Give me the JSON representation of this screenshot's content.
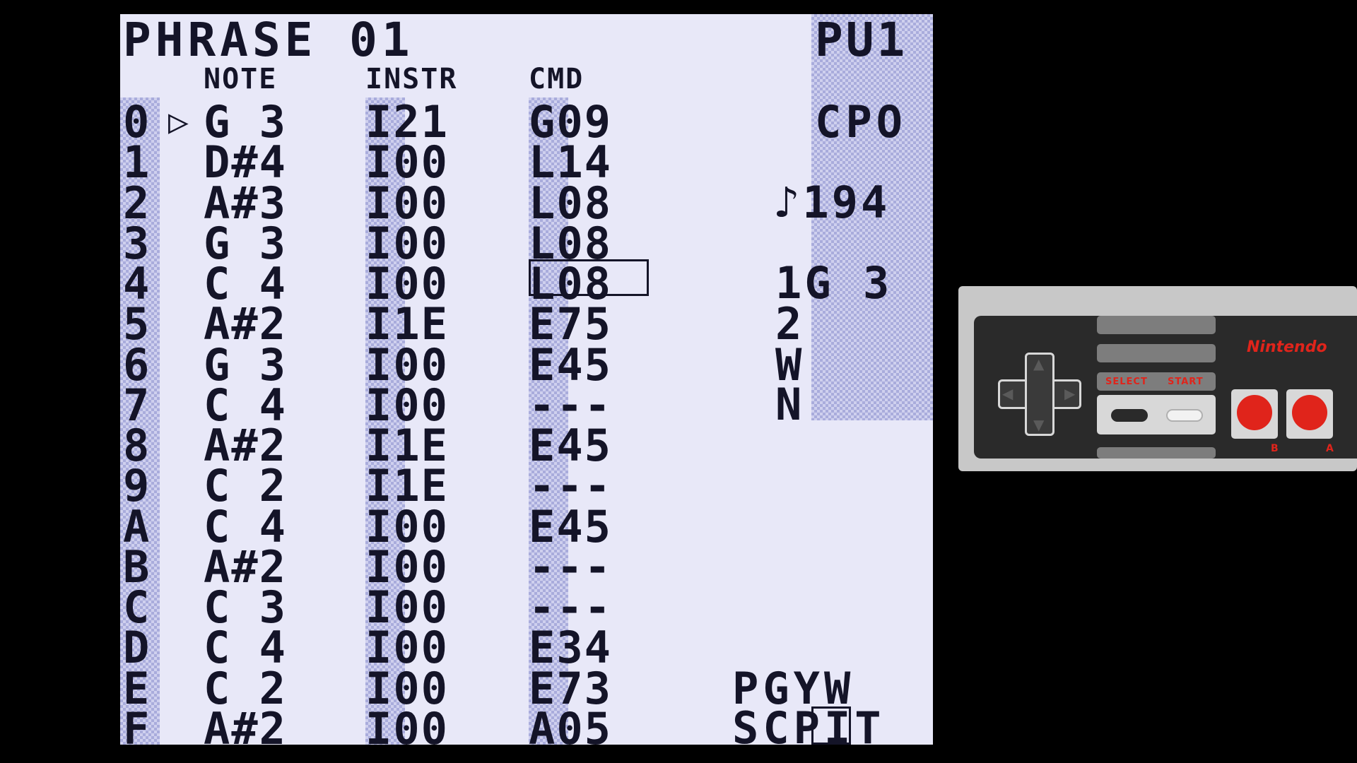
{
  "screen": {
    "title": "PHRASE 01",
    "channel": "PU1",
    "headers": {
      "note": "NOTE",
      "instr": "INSTR",
      "cmd": "CMD"
    },
    "cursor_marker": "▷",
    "rows": [
      {
        "idx": "0",
        "note": "G 3",
        "instr": "I21",
        "cmd": "G09"
      },
      {
        "idx": "1",
        "note": "D#4",
        "instr": "I00",
        "cmd": "L14"
      },
      {
        "idx": "2",
        "note": "A#3",
        "instr": "I00",
        "cmd": "L08"
      },
      {
        "idx": "3",
        "note": "G 3",
        "instr": "I00",
        "cmd": "L08"
      },
      {
        "idx": "4",
        "note": "C 4",
        "instr": "I00",
        "cmd": "L08"
      },
      {
        "idx": "5",
        "note": "A#2",
        "instr": "I1E",
        "cmd": "E75"
      },
      {
        "idx": "6",
        "note": "G 3",
        "instr": "I00",
        "cmd": "E45"
      },
      {
        "idx": "7",
        "note": "C 4",
        "instr": "I00",
        "cmd": "---"
      },
      {
        "idx": "8",
        "note": "A#2",
        "instr": "I1E",
        "cmd": "E45"
      },
      {
        "idx": "9",
        "note": "C 2",
        "instr": "I1E",
        "cmd": "---"
      },
      {
        "idx": "A",
        "note": "C 4",
        "instr": "I00",
        "cmd": "E45"
      },
      {
        "idx": "B",
        "note": "A#2",
        "instr": "I00",
        "cmd": "---"
      },
      {
        "idx": "C",
        "note": "C 3",
        "instr": "I00",
        "cmd": "---"
      },
      {
        "idx": "D",
        "note": "C 4",
        "instr": "I00",
        "cmd": "E34"
      },
      {
        "idx": "E",
        "note": "C 2",
        "instr": "I00",
        "cmd": "E73"
      },
      {
        "idx": "F",
        "note": "A#2",
        "instr": "I00",
        "cmd": "A05"
      }
    ],
    "side": {
      "cpo": "CPO",
      "tempo": "♪194",
      "note_pos": "1G 3",
      "line2": "2",
      "line_w": "W",
      "line_n": "N",
      "map_top": "PGYW",
      "map_bottom": "SCPIT"
    }
  },
  "controller": {
    "brand": "Nintendo",
    "select_label": "SELECT",
    "start_label": "START",
    "b_label": "B",
    "a_label": "A",
    "button_color": "#e0241b"
  }
}
